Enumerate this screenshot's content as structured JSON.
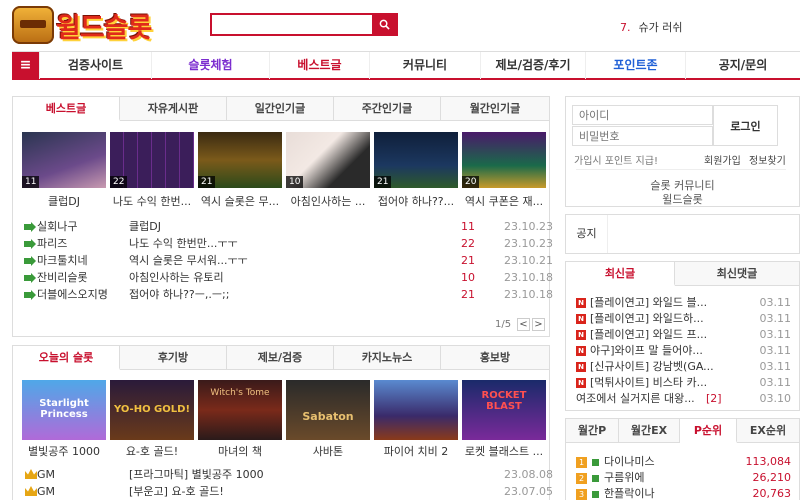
{
  "header": {
    "logo_text": "윌드슬롯",
    "search_placeholder": "",
    "search_icon": "search-icon",
    "rank_number": "7.",
    "rank_keyword": "슈가 러쉬"
  },
  "nav": {
    "menu_icon": "≡",
    "items": [
      "검증사이트",
      "슬롯체험",
      "베스트글",
      "커뮤니티",
      "제보/검증/후기",
      "포인트존",
      "공지/문의"
    ],
    "colors": {
      "default": "#333333",
      "slot": "#7b2ccf",
      "best": "#c8102e",
      "point": "#1f5fd6"
    }
  },
  "best": {
    "tabs": [
      "베스트글",
      "자유게시판",
      "일간인기글",
      "주간인기글",
      "월간인기글"
    ],
    "thumbs": [
      {
        "count": "11",
        "caption": "클럽DJ"
      },
      {
        "count": "22",
        "caption": "나도 수익 한번..."
      },
      {
        "count": "21",
        "caption": "역시 슬롯은 무..."
      },
      {
        "count": "10",
        "caption": "아침인사하는 ..."
      },
      {
        "count": "21",
        "caption": "접어야 하나??..."
      },
      {
        "count": "20",
        "caption": "역시 쿠폰은 재..."
      }
    ],
    "rows": [
      {
        "author": "실회나구",
        "title": "클럽DJ",
        "count": "11",
        "date": "23.10.23"
      },
      {
        "author": "파리즈",
        "title": "나도 수익 한번만...ㅜㅜ",
        "count": "22",
        "date": "23.10.23"
      },
      {
        "author": "마크툴치네",
        "title": "역시 슬롯은 무서워...ㅜㅜ",
        "count": "21",
        "date": "23.10.21"
      },
      {
        "author": "잔비리슬롯",
        "title": "아침인사하는 유토리",
        "count": "10",
        "date": "23.10.18"
      },
      {
        "author": "더블에스오지명",
        "title": "접어야 하나??ㅡ,.ㅡ;;",
        "count": "21",
        "date": "23.10.18"
      }
    ],
    "pager": "1/5",
    "prev": "<",
    "next": ">"
  },
  "today": {
    "tabs": [
      "오늘의 슬롯",
      "후기방",
      "제보/검증",
      "카지노뉴스",
      "홍보방"
    ],
    "thumbs": [
      {
        "caption": "별빛공주 1000",
        "art": "Starlight Princess"
      },
      {
        "caption": "요-호 골드!",
        "art": "YO-HO GOLD!"
      },
      {
        "caption": "마녀의 책",
        "art": "Witch's Tome"
      },
      {
        "caption": "사바톤",
        "art": "Sabaton"
      },
      {
        "caption": "파이어 치비 2",
        "art": ""
      },
      {
        "caption": "로켓 블래스트 ...",
        "art": "ROCKET BLAST"
      }
    ],
    "rows": [
      {
        "author": "GM",
        "title": "[프라그마틱] 별빛공주 1000",
        "date": "23.08.08"
      },
      {
        "author": "GM",
        "title": "[부운고] 요-호 골드!",
        "date": "23.07.05"
      }
    ]
  },
  "login": {
    "id_placeholder": "아이디",
    "pw_placeholder": "비밀번호",
    "login_button": "로그인",
    "signup_point": "가입시 포인트 지급!",
    "join_link": "회원가입",
    "find_link": "정보찾기",
    "community": "슬롯 커뮤니티",
    "site": "윌드슬롯"
  },
  "notice": {
    "label": "공지"
  },
  "latest": {
    "tabs": [
      "최신글",
      "최신댓글"
    ],
    "rows": [
      {
        "title": "[플레이연고] 와일드 블...",
        "date": "03.11"
      },
      {
        "title": "[플레이연고] 와일드하...",
        "date": "03.11"
      },
      {
        "title": "[플레이연고] 와일드 프...",
        "date": "03.11"
      },
      {
        "title": "야구]와이프 말 들어야...",
        "date": "03.11"
      },
      {
        "title": "[신규사이트] 강남벳(GA...",
        "date": "03.11"
      },
      {
        "title": "[먹튀사이트] 비스타 카...",
        "date": "03.11"
      }
    ],
    "last": {
      "title": "여조에서 실거지른 대왕...",
      "comments": "[2]",
      "date": "03.10"
    }
  },
  "ranking": {
    "tabs": [
      "월간P",
      "월간EX",
      "P순위",
      "EX순위"
    ],
    "rows": [
      {
        "rank": "1",
        "name": "다이나미스",
        "points": "113,084"
      },
      {
        "rank": "2",
        "name": "구름위에",
        "points": "26,210"
      },
      {
        "rank": "3",
        "name": "한플락이나",
        "points": "20,763"
      }
    ]
  },
  "colors": {
    "accent": "#c8102e",
    "green": "#3a9a3a",
    "gold": "#e6a614"
  }
}
